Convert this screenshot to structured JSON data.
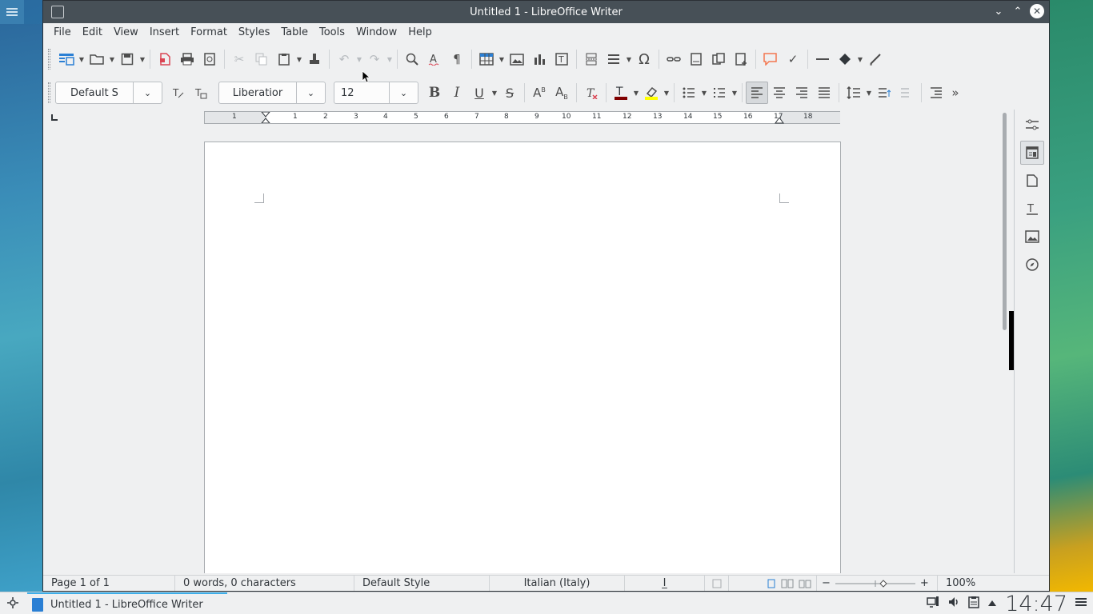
{
  "window": {
    "title": "Untitled 1 - LibreOffice Writer",
    "minimize_icon": "⌄",
    "maximize_icon": "⌃",
    "close_icon": "✕"
  },
  "menubar": {
    "items": [
      "File",
      "Edit",
      "View",
      "Insert",
      "Format",
      "Styles",
      "Table",
      "Tools",
      "Window",
      "Help"
    ]
  },
  "formatting": {
    "paragraph_style": "Default S",
    "font_name": "Liberatior",
    "font_size": "12"
  },
  "ruler": {
    "labels": [
      "1",
      "1",
      "2",
      "3",
      "4",
      "5",
      "6",
      "7",
      "8",
      "9",
      "10",
      "11",
      "12",
      "13",
      "14",
      "15",
      "16",
      "17",
      "18"
    ]
  },
  "statusbar": {
    "page": "Page 1 of 1",
    "word_count": "0 words, 0 characters",
    "page_style": "Default Style",
    "language": "Italian (Italy)",
    "insert_mode": "I̲",
    "zoom_minus": "−",
    "zoom_plus": "+",
    "zoom": "100%"
  },
  "taskbar": {
    "task_label": "Untitled 1 - LibreOffice Writer",
    "clock": "14:47"
  }
}
